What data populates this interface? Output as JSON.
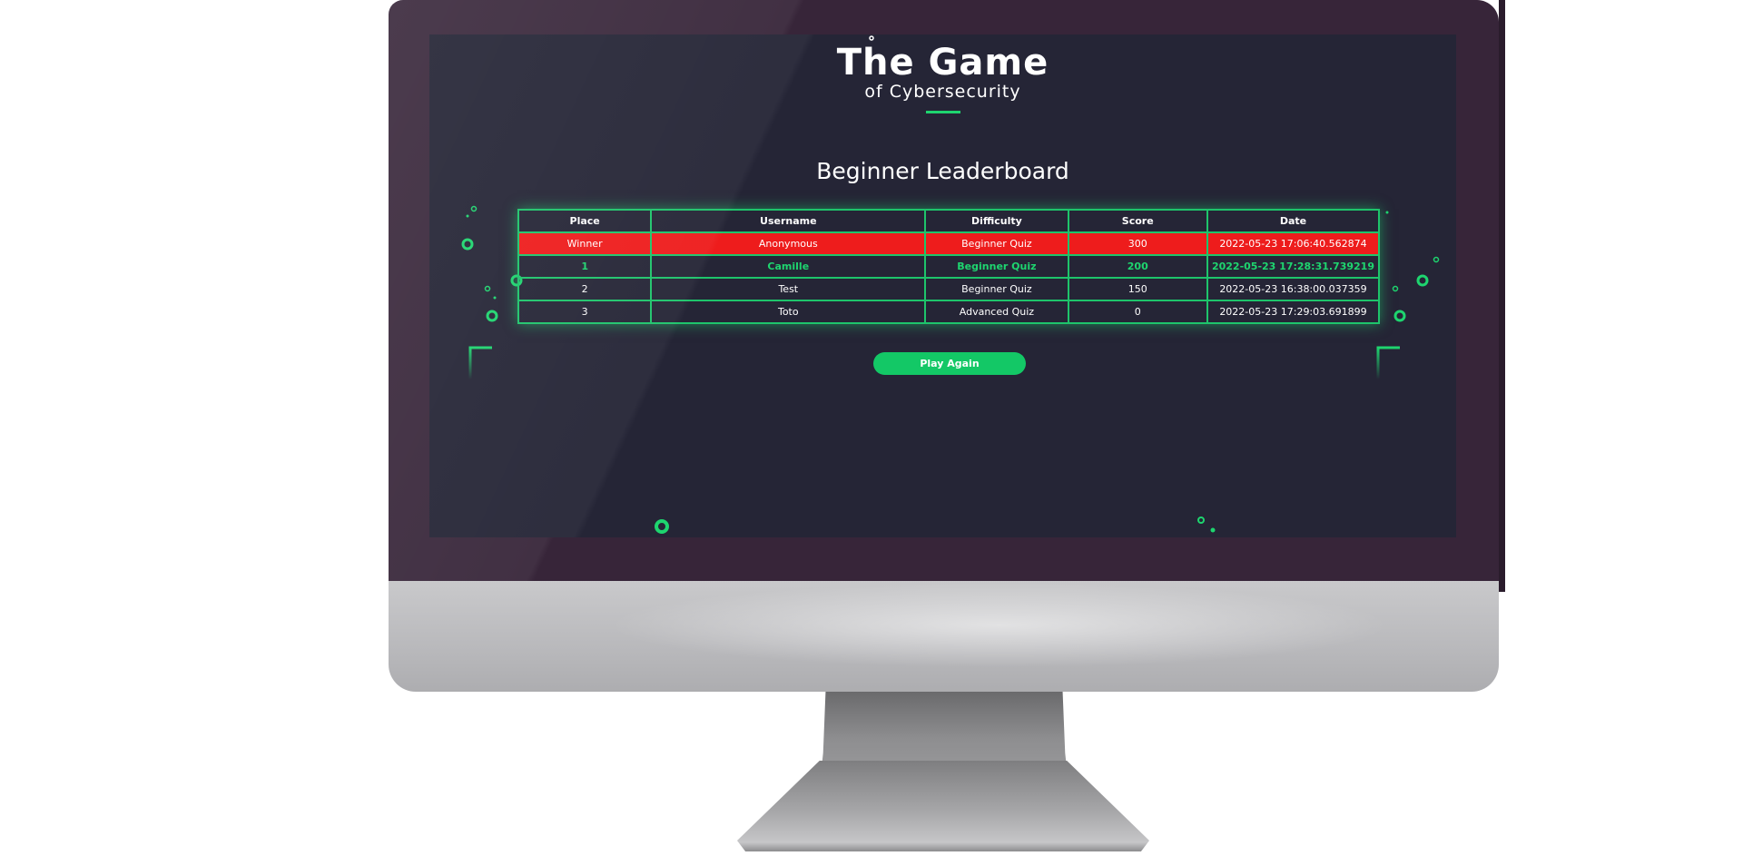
{
  "app": {
    "logo_title": "The Game",
    "logo_subtitle": "of Cybersecurity"
  },
  "page": {
    "title": "Beginner Leaderboard"
  },
  "leaderboard": {
    "columns": [
      "Place",
      "Username",
      "Difficulty",
      "Score",
      "Date"
    ],
    "rows": [
      {
        "place": "Winner",
        "username": "Anonymous",
        "difficulty": "Beginner Quiz",
        "score": "300",
        "date": "2022-05-23 17:06:40.562874",
        "style": "winner"
      },
      {
        "place": "1",
        "username": "Camille",
        "difficulty": "Beginner Quiz",
        "score": "200",
        "date": "2022-05-23 17:28:31.739219",
        "style": "current"
      },
      {
        "place": "2",
        "username": "Test",
        "difficulty": "Beginner Quiz",
        "score": "150",
        "date": "2022-05-23 16:38:00.037359",
        "style": "normal"
      },
      {
        "place": "3",
        "username": "Toto",
        "difficulty": "Advanced Quiz",
        "score": "0",
        "date": "2022-05-23 17:29:03.691899",
        "style": "normal"
      }
    ]
  },
  "actions": {
    "play_again": "Play Again"
  },
  "colors": {
    "accent": "#1ed56f",
    "winner_row": "#ee1c1c",
    "screen_bg": "#252536",
    "bezel": "#372539"
  },
  "icons": {
    "decor": "circuit-lines"
  }
}
